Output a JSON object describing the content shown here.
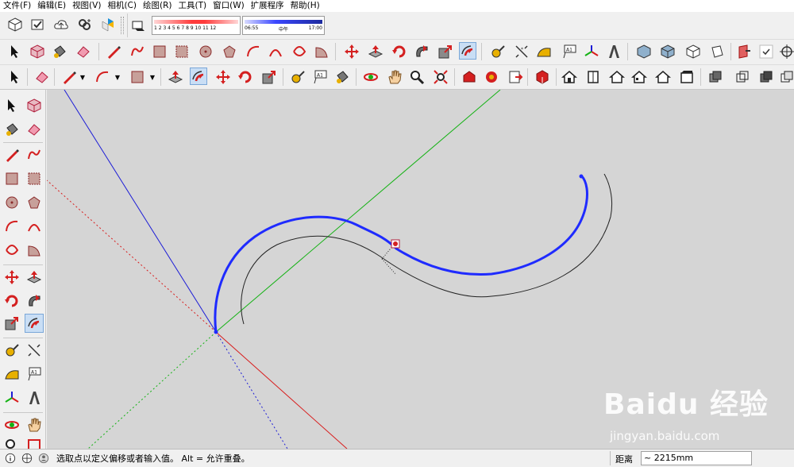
{
  "menubar": {
    "items": [
      "文件(F)",
      "编辑(E)",
      "视图(V)",
      "相机(C)",
      "绘图(R)",
      "工具(T)",
      "窗口(W)",
      "扩展程序",
      "帮助(H)"
    ]
  },
  "shadow": {
    "months": "1 2 3 4 5 6 7 8 9 10 11 12",
    "time_start": "06:55",
    "time_mid": "中午",
    "time_end": "17:00"
  },
  "status": {
    "message": "选取点以定义偏移或者输入值。 Alt = 允许重叠。",
    "measure_label": "距离",
    "measure_value": "~ 2215mm"
  },
  "watermark": {
    "brand_text": "Baidu 经验",
    "url": "jingyan.baidu.com"
  },
  "colors": {
    "axis_blue": "#1c1cd6",
    "axis_green": "#14b214",
    "axis_red": "#d81c1c",
    "selected_curve": "#1f2bff",
    "offset_curve": "#222222",
    "viewport_bg": "#d5d5d5"
  }
}
